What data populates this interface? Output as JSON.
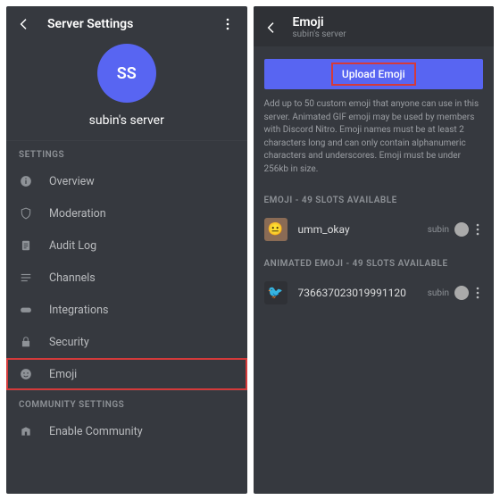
{
  "left": {
    "header_title": "Server Settings",
    "avatar_initials": "SS",
    "server_name": "subin's server",
    "section_settings": "SETTINGS",
    "section_community": "COMMUNITY SETTINGS",
    "items": {
      "overview": "Overview",
      "moderation": "Moderation",
      "audit_log": "Audit Log",
      "channels": "Channels",
      "integrations": "Integrations",
      "security": "Security",
      "emoji": "Emoji",
      "enable_community": "Enable Community"
    }
  },
  "right": {
    "title": "Emoji",
    "subtitle": "subin's server",
    "upload_label": "Upload Emoji",
    "description": "Add up to 50 custom emoji that anyone can use in this server. Animated GIF emoji may be used by members with Discord Nitro. Emoji names must be at least 2 characters long and can only contain alphanumeric characters and underscores. Emoji must be under 256kb in size.",
    "static_label": "EMOJI - 49 SLOTS AVAILABLE",
    "animated_label": "ANIMATED EMOJI - 49 SLOTS AVAILABLE",
    "rows": {
      "r1_name": "umm_okay",
      "r1_user": "subin",
      "r2_name": "736637023019991120",
      "r2_user": "subin"
    }
  }
}
